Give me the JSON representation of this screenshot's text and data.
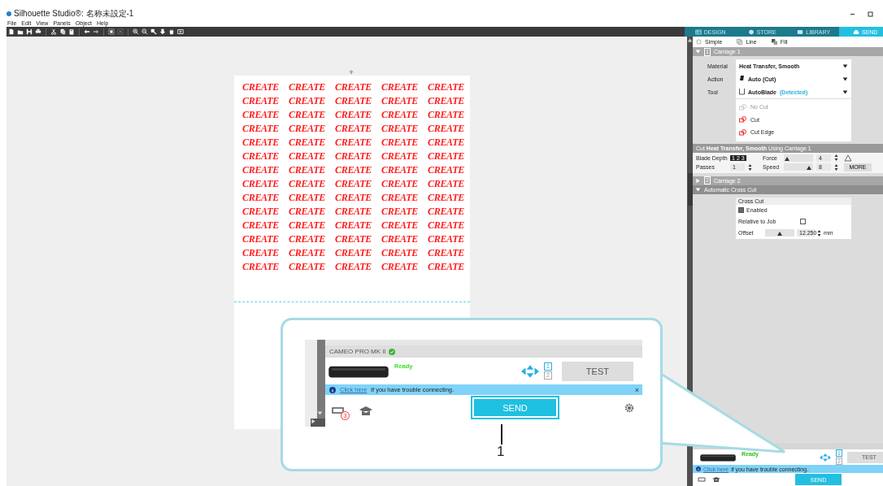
{
  "window": {
    "title": "Silhouette Studio®: 名称未設定-1"
  },
  "menu": [
    "File",
    "Edit",
    "View",
    "Panels",
    "Object",
    "Help"
  ],
  "design": {
    "rows": [
      [
        "CREATE",
        "CREATE",
        "CREATE",
        "CREATE",
        "CREATE"
      ],
      [
        "CREATE",
        "CREATE",
        "CREATE",
        "CREATE",
        "CREATE"
      ],
      [
        "CREATE",
        "CREATE",
        "CREATE",
        "CREATE",
        "CREATE"
      ],
      [
        "CREATE",
        "CREATE",
        "CREATE",
        "CREATE",
        "CREATE"
      ],
      [
        "CREATE",
        "CREATE",
        "CREATE",
        "CREATE",
        "CREATE"
      ],
      [
        "CREATE",
        "CREATE",
        "CREATE",
        "CREATE",
        "CREATE"
      ],
      [
        "CREATE",
        "CREATE",
        "CREATE",
        "CREATE",
        "CREATE"
      ],
      [
        "CREATE",
        "CREATE",
        "CREATE",
        "CREATE",
        "CREATE"
      ],
      [
        "CREATE",
        "CREATE",
        "CREATE",
        "CREATE",
        "CREATE"
      ],
      [
        "CREATE",
        "CREATE",
        "CREATE",
        "CREATE",
        "CREATE"
      ],
      [
        "CREATE",
        "CREATE",
        "CREATE",
        "CREATE",
        "CREATE"
      ],
      [
        "CREATE",
        "CREATE",
        "CREATE",
        "CREATE",
        "CREATE"
      ],
      [
        "CREATE",
        "CREATE",
        "CREATE",
        "CREATE",
        "CREATE"
      ],
      [
        "CREATE",
        "CREATE",
        "CREATE",
        "CREATE",
        "CREATE"
      ]
    ]
  },
  "panel": {
    "tabs": [
      {
        "label": "DESIGN",
        "selected": false
      },
      {
        "label": "STORE",
        "selected": false
      },
      {
        "label": "LIBRARY",
        "selected": false
      },
      {
        "label": "SEND",
        "selected": true
      }
    ],
    "modes": [
      {
        "label": "Simple",
        "kind": "radio",
        "selected": false
      },
      {
        "label": "Line",
        "kind": "line",
        "selected": false
      },
      {
        "label": "Fill",
        "kind": "fill",
        "selected": false
      }
    ],
    "carriage1": {
      "number": "1",
      "label": "Carriage 1",
      "expanded": true
    },
    "settings": [
      {
        "label": "Material",
        "kind": "material",
        "value": "Heat Transfer, Smooth"
      },
      {
        "label": "Action",
        "kind": "action",
        "value": "Auto (Cut)"
      },
      {
        "label": "Tool",
        "kind": "tool",
        "value": "AutoBlade",
        "note": "(Detected)"
      }
    ],
    "tool_options": [
      {
        "label": "No Cut",
        "disabled": true
      },
      {
        "label": "Cut",
        "disabled": false
      },
      {
        "label": "Cut Edge",
        "disabled": false
      }
    ],
    "cut_header": "Cut **Heat Transfer, Smooth** Using Carriage 1",
    "blade_depth": {
      "label": "Blade Depth",
      "steps": [
        "1",
        "2",
        "3"
      ]
    },
    "force": {
      "label": "Force",
      "level": 0.1,
      "value": "4"
    },
    "passes": {
      "label": "Passes",
      "value": "1"
    },
    "speed": {
      "label": "Speed",
      "level": 0.85,
      "value": "8"
    },
    "more_button": "MORE",
    "carriage2": {
      "number": "2",
      "label": "Carriage 2",
      "expanded": false
    },
    "cross_cut": {
      "label": "Automatic Cross Cut",
      "expanded": true,
      "group": "Cross Cut",
      "options": [
        {
          "label": "Enabled",
          "checked": true
        },
        {
          "label": "Relative to Job",
          "checked": false
        }
      ],
      "offset": {
        "label": "Offset",
        "level": 0.5,
        "value": "12.250",
        "unit": "mm"
      }
    },
    "machine": {
      "status": "Ready",
      "carriages": [
        {
          "label": "1",
          "selected": true
        },
        {
          "label": "2",
          "selected": false
        }
      ],
      "test_button": "TEST",
      "info": {
        "link": "Click here",
        "text": "if you have trouble connecting."
      },
      "send_button": "SEND"
    }
  },
  "callout": {
    "machine_name": "CAMEO PRO MK II",
    "status": "Ready",
    "carriages": [
      {
        "label": "1",
        "selected": true
      },
      {
        "label": "2",
        "selected": false
      }
    ],
    "test_button": "TEST",
    "info": {
      "link": "Click here",
      "text": "if you have trouble connecting."
    },
    "close": "×",
    "badge": "3",
    "send_button": "SEND",
    "label": "1"
  }
}
